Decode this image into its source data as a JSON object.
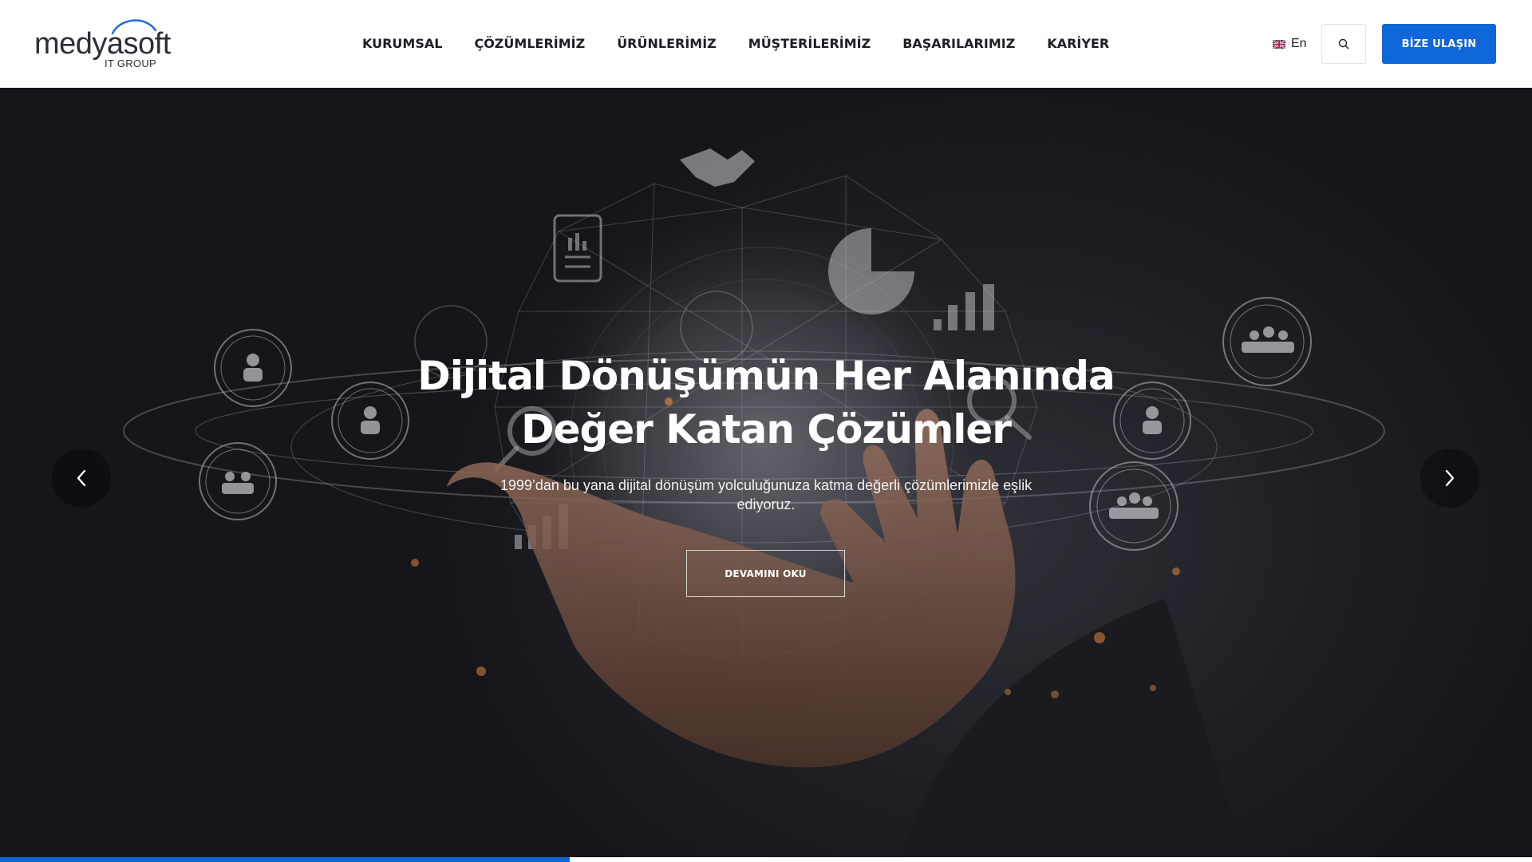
{
  "header": {
    "logo": {
      "name": "medyasoft",
      "sub": "IT GROUP"
    },
    "nav": [
      {
        "label": "KURUMSAL"
      },
      {
        "label": "ÇÖZÜMLERİMİZ"
      },
      {
        "label": "ÜRÜNLERİMİZ"
      },
      {
        "label": "MÜŞTERİLERİMİZ"
      },
      {
        "label": "BAŞARILARIMIZ"
      },
      {
        "label": "KARİYER"
      }
    ],
    "language": {
      "label": "En",
      "icon": "uk-flag-icon"
    },
    "search_icon": "search-icon",
    "contact_label": "BİZE ULAŞIN",
    "accent_color": "#0e66d9"
  },
  "hero": {
    "title_line1": "Dijital Dönüşümün Her Alanında",
    "title_line2": "Değer Katan Çözümler",
    "subtitle": "1999’dan bu yana dijital dönüşüm yolculuğunuza katma değerli çözümlerimizle eşlik ediyoruz.",
    "button_label": "DEVAMINI OKU",
    "prev_icon": "chevron-left-icon",
    "next_icon": "chevron-right-icon",
    "progress_fraction": 0.372
  }
}
